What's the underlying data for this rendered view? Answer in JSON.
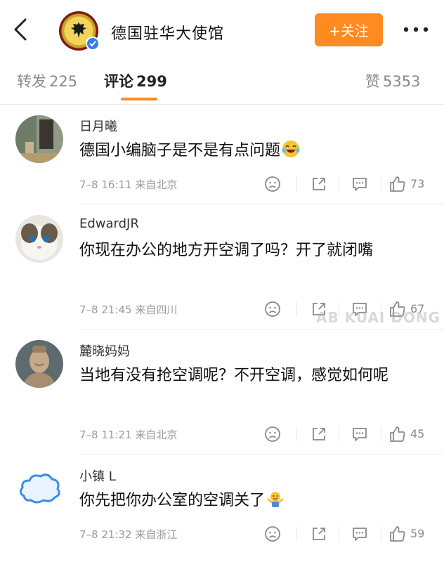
{
  "header": {
    "account_name": "德国驻华大使馆",
    "follow_label": "+关注"
  },
  "tabs": {
    "repost_label": "转发",
    "repost_count": "225",
    "comments_label": "评论",
    "comments_count": "299",
    "likes_label": "赞",
    "likes_count": "5353"
  },
  "comments": [
    {
      "name": "日月曦",
      "text": "德国小编脑子是不是有点问题",
      "emoji": "laughing-tears",
      "time": "7–8 16:11",
      "location": "来自北京",
      "likes": "73"
    },
    {
      "name": "EdwardJR",
      "text": "你现在办公的地方开空调了吗？开了就闭嘴",
      "time": "7–8 21:45",
      "location": "来自四川",
      "likes": "67"
    },
    {
      "name": "麓晓妈妈",
      "text": "当地有没有抢空调呢？不开空调，感觉如何呢",
      "time": "7–8 11:21",
      "location": "来自北京",
      "likes": "45"
    },
    {
      "name": "小镇 L",
      "text": "你先把你办公室的空调关了",
      "emoji": "shrug",
      "time": "7–8 21:32",
      "location": "来自浙江",
      "likes": "59"
    }
  ],
  "watermark": "AB KUAI DONG",
  "colors": {
    "accent": "#ff8a1f",
    "verified": "#2f80ed"
  }
}
